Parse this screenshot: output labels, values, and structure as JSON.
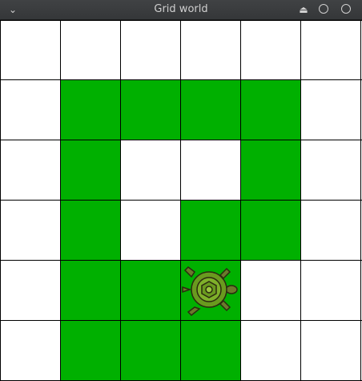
{
  "window": {
    "title": "Grid world",
    "menu_icon": "chevron-down-icon",
    "eject_icon": "eject-icon",
    "minimize_icon": "circle-icon",
    "close_icon": "circle-icon"
  },
  "grid": {
    "rows": 6,
    "cols": 6,
    "colors": {
      "filled": "#00b000",
      "empty": "#ffffff",
      "line": "#000000"
    },
    "filled_cells": [
      [
        1,
        1
      ],
      [
        1,
        2
      ],
      [
        1,
        3
      ],
      [
        1,
        4
      ],
      [
        2,
        1
      ],
      [
        2,
        4
      ],
      [
        3,
        1
      ],
      [
        3,
        3
      ],
      [
        3,
        4
      ],
      [
        4,
        1
      ],
      [
        4,
        2
      ],
      [
        4,
        3
      ],
      [
        5,
        1
      ],
      [
        5,
        2
      ],
      [
        5,
        3
      ]
    ]
  },
  "turtle": {
    "icon": "turtle-icon",
    "row": 4,
    "col": 3,
    "heading": "right",
    "shell_color": "#6a9a1f",
    "body_color": "#6b7a2c"
  }
}
